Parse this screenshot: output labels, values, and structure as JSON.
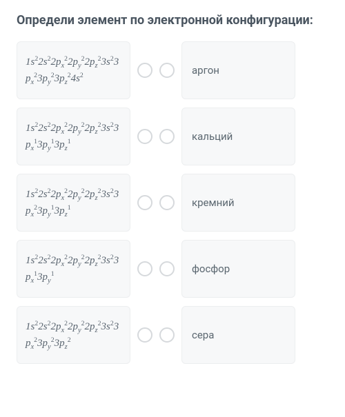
{
  "question": {
    "title": "Определи элемент по электронной конфигурации:"
  },
  "rows": [
    {
      "formula_html": "1<i>s</i><sup>2</sup>2<i>s</i><sup>2</sup>2<i>p</i><sub>x</sub><sup>2</sup>2<i>p</i><sub>y</sub><sup>2</sup>2<i>p</i><sub>z</sub><sup>2</sup>3<i>s</i><sup>2</sup>3<i>p</i><sub>x</sub><sup>2</sup>3<i>p</i><sub>y</sub><sup>2</sup>3<i>p</i><sub>z</sub><sup>2</sup>4<i>s</i><sup>2</sup>",
      "element": "аргон"
    },
    {
      "formula_html": "1<i>s</i><sup>2</sup>2<i>s</i><sup>2</sup>2<i>p</i><sub>x</sub><sup>2</sup>2<i>p</i><sub>y</sub><sup>2</sup>2<i>p</i><sub>z</sub><sup>2</sup>3<i>s</i><sup>2</sup>3<i>p</i><sub>x</sub><sup>1</sup>3<i>p</i><sub>y</sub><sup>1</sup>3<i>p</i><sub>z</sub><sup>1</sup>",
      "element": "кальций"
    },
    {
      "formula_html": "1<i>s</i><sup>2</sup>2<i>s</i><sup>2</sup>2<i>p</i><sub>x</sub><sup>2</sup>2<i>p</i><sub>y</sub><sup>2</sup>2<i>p</i><sub>z</sub><sup>2</sup>3<i>s</i><sup>2</sup>3<i>p</i><sub>x</sub><sup>2</sup>3<i>p</i><sub>y</sub><sup>1</sup>3<i>p</i><sub>z</sub><sup>1</sup>",
      "element": "кремний"
    },
    {
      "formula_html": "1<i>s</i><sup>2</sup>2<i>s</i><sup>2</sup>2<i>p</i><sub>x</sub><sup>2</sup>2<i>p</i><sub>y</sub><sup>2</sup>2<i>p</i><sub>z</sub><sup>2</sup>3<i>s</i><sup>2</sup>3<i>p</i><sub>x</sub><sup>1</sup>3<i>p</i><sub>y</sub><sup>1</sup>",
      "element": "фосфор"
    },
    {
      "formula_html": "1<i>s</i><sup>2</sup>2<i>s</i><sup>2</sup>2<i>p</i><sub>x</sub><sup>2</sup>2<i>p</i><sub>y</sub><sup>2</sup>2<i>p</i><sub>z</sub><sup>2</sup>3<i>s</i><sup>2</sup>3<i>p</i><sub>x</sub><sup>2</sup>3<i>p</i><sub>y</sub><sup>2</sup>3<i>p</i><sub>z</sub><sup>2</sup>",
      "element": "сера"
    }
  ]
}
